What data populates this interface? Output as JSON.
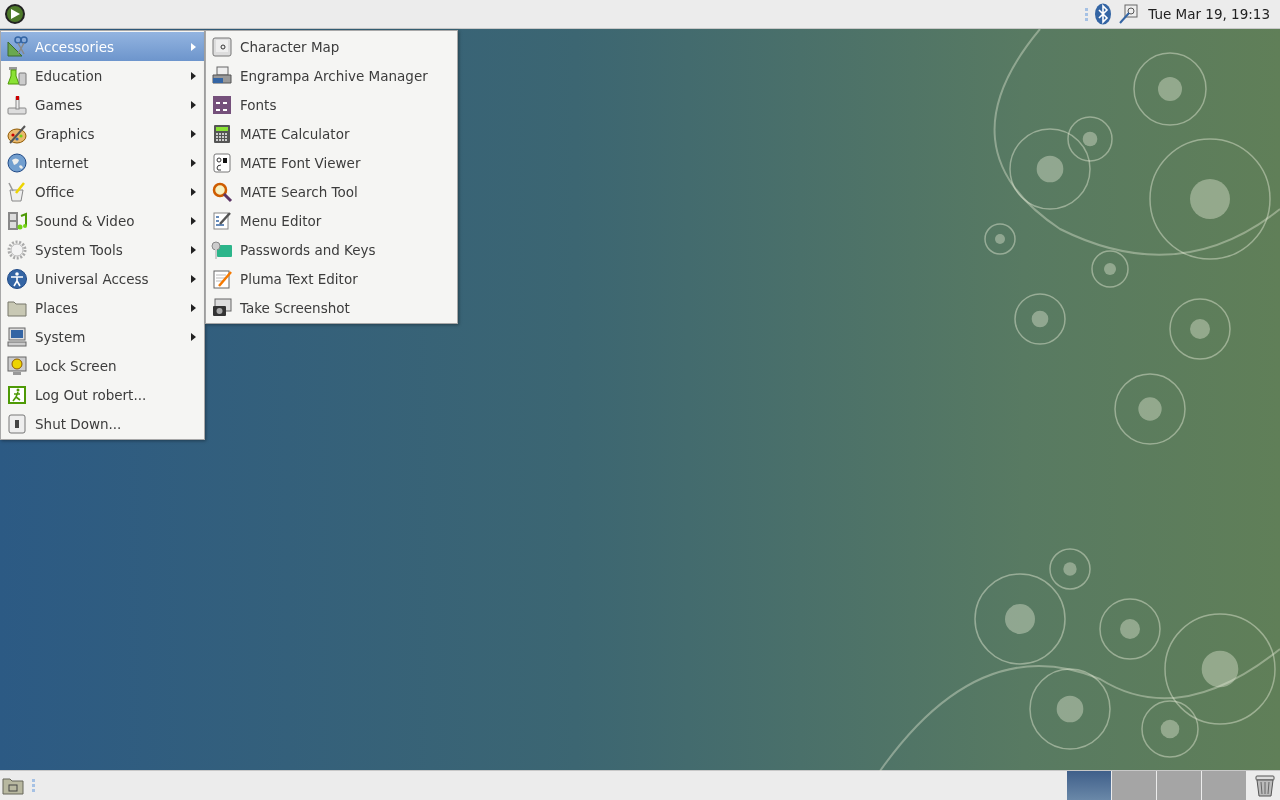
{
  "top_panel": {
    "clock": "Tue Mar 19, 19:13"
  },
  "main_menu": {
    "items": [
      {
        "label": "Accessories",
        "selected": true,
        "has_submenu": true
      },
      {
        "label": "Education",
        "selected": false,
        "has_submenu": true
      },
      {
        "label": "Games",
        "selected": false,
        "has_submenu": true
      },
      {
        "label": "Graphics",
        "selected": false,
        "has_submenu": true
      },
      {
        "label": "Internet",
        "selected": false,
        "has_submenu": true
      },
      {
        "label": "Office",
        "selected": false,
        "has_submenu": true
      },
      {
        "label": "Sound & Video",
        "selected": false,
        "has_submenu": true
      },
      {
        "label": "System Tools",
        "selected": false,
        "has_submenu": true
      },
      {
        "label": "Universal Access",
        "selected": false,
        "has_submenu": true
      },
      {
        "label": "Places",
        "selected": false,
        "has_submenu": true
      },
      {
        "label": "System",
        "selected": false,
        "has_submenu": true
      },
      {
        "label": "Lock Screen",
        "selected": false,
        "has_submenu": false
      },
      {
        "label": "Log Out robert...",
        "selected": false,
        "has_submenu": false
      },
      {
        "label": "Shut Down...",
        "selected": false,
        "has_submenu": false
      }
    ]
  },
  "submenu": {
    "items": [
      {
        "label": "Character Map"
      },
      {
        "label": "Engrampa Archive Manager"
      },
      {
        "label": "Fonts"
      },
      {
        "label": "MATE Calculator"
      },
      {
        "label": "MATE Font Viewer"
      },
      {
        "label": "MATE Search Tool"
      },
      {
        "label": "Menu Editor"
      },
      {
        "label": "Passwords and Keys"
      },
      {
        "label": "Pluma Text Editor"
      },
      {
        "label": "Take Screenshot"
      }
    ]
  },
  "bottom_panel": {
    "workspaces": [
      {
        "selected": true
      },
      {
        "selected": false
      },
      {
        "selected": false
      },
      {
        "selected": false
      }
    ]
  }
}
